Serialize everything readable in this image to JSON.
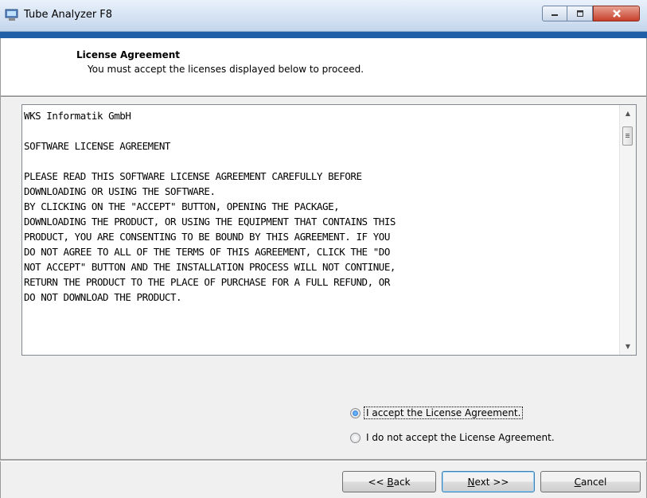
{
  "window": {
    "title": "Tube Analyzer F8",
    "icon": "installer-computer-icon"
  },
  "header": {
    "title": "License Agreement",
    "subtitle": "You must accept the licenses displayed below to proceed."
  },
  "license": {
    "text": "WKS Informatik GmbH\n\nSOFTWARE LICENSE AGREEMENT\n\nPLEASE READ THIS SOFTWARE LICENSE AGREEMENT CAREFULLY BEFORE\nDOWNLOADING OR USING THE SOFTWARE.\nBY CLICKING ON THE \"ACCEPT\" BUTTON, OPENING THE PACKAGE,\nDOWNLOADING THE PRODUCT, OR USING THE EQUIPMENT THAT CONTAINS THIS\nPRODUCT, YOU ARE CONSENTING TO BE BOUND BY THIS AGREEMENT. IF YOU\nDO NOT AGREE TO ALL OF THE TERMS OF THIS AGREEMENT, CLICK THE \"DO\nNOT ACCEPT\" BUTTON AND THE INSTALLATION PROCESS WILL NOT CONTINUE,\nRETURN THE PRODUCT TO THE PLACE OF PURCHASE FOR A FULL REFUND, OR\nDO NOT DOWNLOAD THE PRODUCT."
  },
  "options": {
    "accept_label": "I accept the License Agreement.",
    "decline_label": "I do not accept the License Agreement.",
    "selected": "accept"
  },
  "buttons": {
    "back_prefix": "<< ",
    "back_key": "B",
    "back_rest": "ack",
    "next_key": "N",
    "next_rest": "ext >>",
    "cancel_key": "C",
    "cancel_rest": "ancel"
  },
  "colors": {
    "accent_strip": "#1f5fa8",
    "close_button": "#c7402a"
  }
}
